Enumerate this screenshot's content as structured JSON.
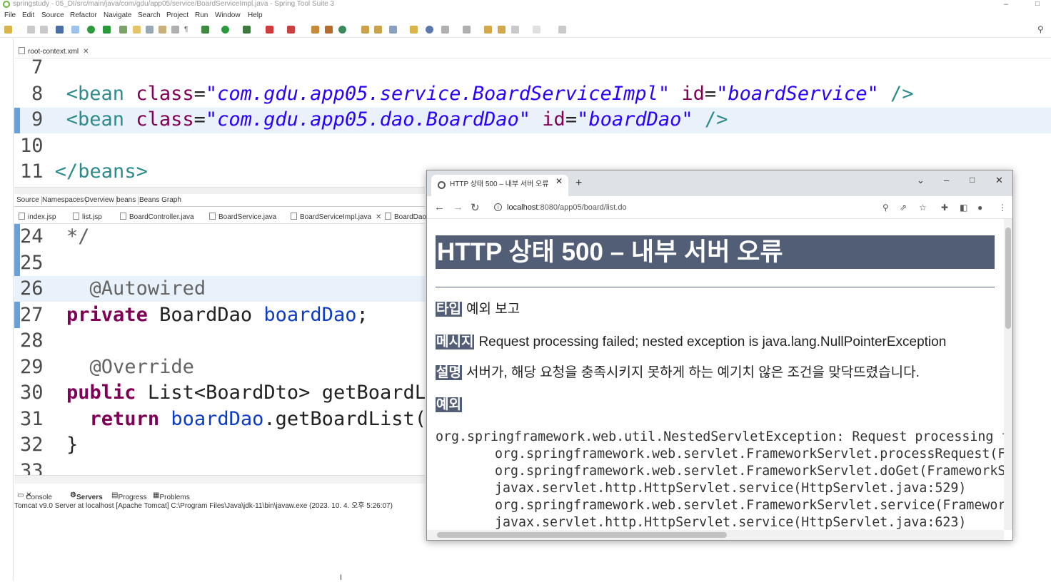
{
  "window": {
    "title": "springstudy - 05_DI/src/main/java/com/gdu/app05/service/BoardServiceImpl.java - Spring Tool Suite 3"
  },
  "menu": [
    "File",
    "Edit",
    "Source",
    "Refactor",
    "Navigate",
    "Search",
    "Project",
    "Run",
    "Window",
    "Help"
  ],
  "editor_top": {
    "tab": "root-context.xml",
    "lines": [
      {
        "num": "7"
      },
      {
        "num": "8",
        "tag_open": "<bean",
        "attr1": "class",
        "val1": "\"com.gdu.app05.service.BoardServiceImpl\"",
        "attr2": "id",
        "val2": "\"boardService\"",
        "tag_close": "/>"
      },
      {
        "num": "9",
        "tag_open": "<bean",
        "attr1": "class",
        "val1": "\"com.gdu.app05.dao.BoardDao\"",
        "attr2": "id",
        "val2": "\"boardDao\"",
        "tag_close": "/>"
      },
      {
        "num": "10"
      },
      {
        "num": "11",
        "text": "</beans>"
      }
    ],
    "subtabs": [
      "Source",
      "Namespaces",
      "Overview",
      "beans",
      "Beans Graph"
    ]
  },
  "editor_bottom": {
    "tabs": [
      "index.jsp",
      "list.jsp",
      "BoardController.java",
      "BoardService.java",
      "BoardServiceImpl.java",
      "BoardDao"
    ],
    "lines": [
      {
        "num": "24",
        "text": "  */"
      },
      {
        "num": "25",
        "text": ""
      },
      {
        "num": "26",
        "text": "  @Autowired"
      },
      {
        "num": "27",
        "kw": "private",
        "type": "BoardDao",
        "field": "boardDao",
        "tail": ";"
      },
      {
        "num": "28",
        "text": ""
      },
      {
        "num": "29",
        "text": "  @Override"
      },
      {
        "num": "30",
        "kw": "public",
        "type": "List<BoardDto>",
        "rest": "getBoardL"
      },
      {
        "num": "31",
        "kw": "return",
        "field": "boardDao",
        "rest": ".getBoardList("
      },
      {
        "num": "32",
        "text": "  }"
      },
      {
        "num": "33",
        "text": ""
      }
    ]
  },
  "console": {
    "tabs": [
      "Console",
      "Servers",
      "Progress",
      "Problems"
    ],
    "line": "Tomcat v9.0 Server at localhost [Apache Tomcat] C:\\Program Files\\Java\\jdk-11\\bin\\javaw.exe  (2023. 10. 4. 오후 5:26:07)"
  },
  "browser": {
    "tab_title": "HTTP 상태 500 – 내부 서버 오류",
    "url_host": "localhost",
    "url_path": ":8080/app05/board/list.do",
    "heading": "HTTP 상태 500 – 내부 서버 오류",
    "type_label": "타입",
    "type_value": "예외 보고",
    "message_label": "메시지",
    "message_value": "Request processing failed; nested exception is java.lang.NullPointerException",
    "desc_label": "설명",
    "desc_value": "서버가, 해당 요청을 충족시키지 못하게 하는 예기치 않은 조건을 맞닥뜨렸습니다.",
    "exception_label": "예외",
    "trace": [
      "org.springframework.web.util.NestedServletException: Request processing faile",
      "\torg.springframework.web.servlet.FrameworkServlet.processRequest(Frame",
      "\torg.springframework.web.servlet.FrameworkServlet.doGet(FrameworkServl",
      "\tjavax.servlet.http.HttpServlet.service(HttpServlet.java:529)",
      "\torg.springframework.web.servlet.FrameworkServlet.service(FrameworkSer",
      "\tjavax.servlet.http.HttpServlet.service(HttpServlet.java:623)"
    ]
  },
  "colors": {
    "accent": "#525d76",
    "xml_tag": "#2e8b8b",
    "keyword": "#7f0055",
    "string": "#2a00ff",
    "field": "#0c3bc6"
  }
}
